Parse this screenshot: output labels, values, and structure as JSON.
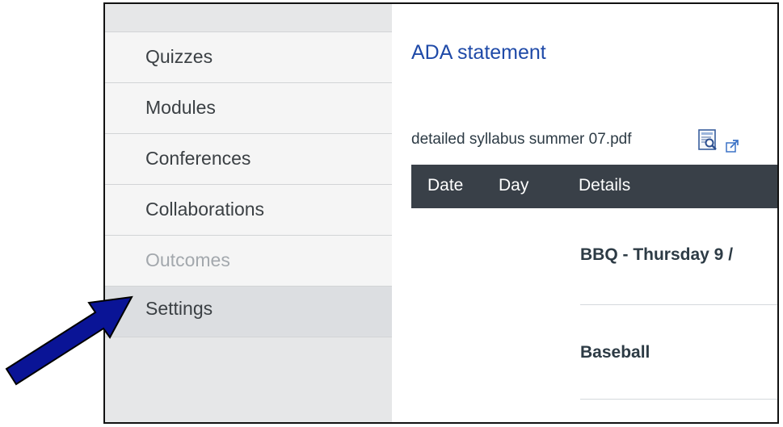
{
  "sidebar": {
    "items": [
      {
        "label": "Quizzes",
        "state": "normal"
      },
      {
        "label": "Modules",
        "state": "normal"
      },
      {
        "label": "Conferences",
        "state": "normal"
      },
      {
        "label": "Collaborations",
        "state": "normal"
      },
      {
        "label": "Outcomes",
        "state": "disabled"
      },
      {
        "label": "Settings",
        "state": "active"
      }
    ]
  },
  "main": {
    "title": "ADA statement",
    "file_link": "detailed syllabus summer 07.pdf",
    "file_icons": [
      "pdf-preview-icon",
      "external-link-icon"
    ],
    "table": {
      "headers": [
        "Date",
        "Day",
        "Details"
      ],
      "rows": [
        {
          "details": "BBQ - Thursday 9 /"
        },
        {
          "details": "Baseball"
        }
      ]
    }
  },
  "annotation": {
    "icon": "pointer-arrow-icon",
    "color": "#0a1496"
  },
  "colors": {
    "link": "#1f4aa8",
    "table_header": "#394048",
    "sidebar_bg": "#f5f5f5",
    "sidebar_active": "#dcdee1",
    "disabled_text": "#a3a8ad"
  }
}
